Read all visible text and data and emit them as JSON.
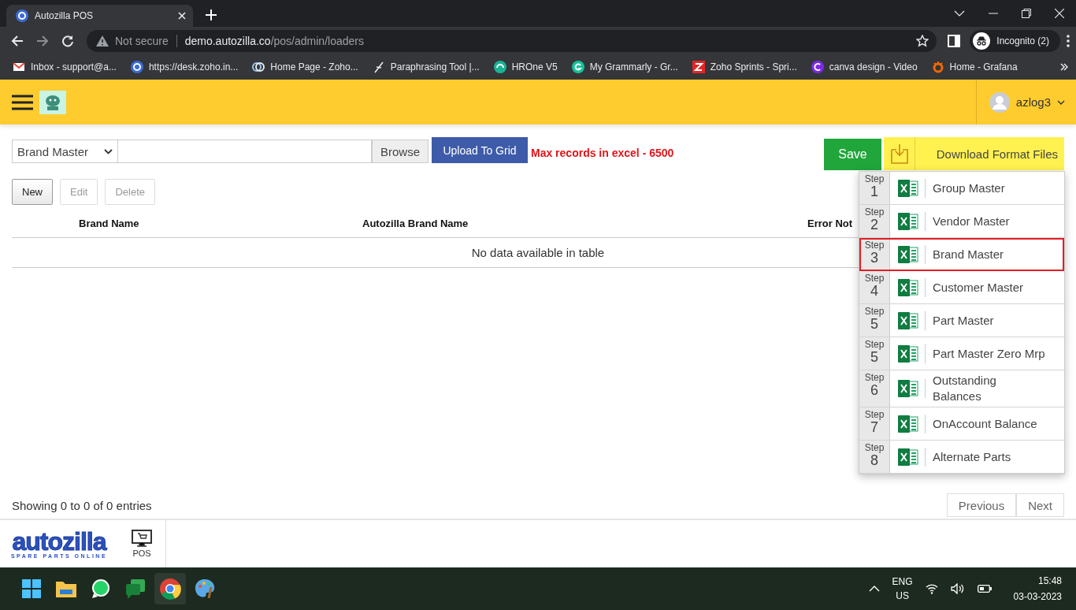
{
  "browser": {
    "tabs": [
      {
        "title": "Autozilla POS",
        "selected": true
      }
    ],
    "url": {
      "security": "Not secure",
      "host": "demo.autozilla.co",
      "path": "/pos/admin/loaders"
    },
    "profile": "Incognito (2)",
    "bookmarks": [
      {
        "label": "Inbox - support@a..."
      },
      {
        "label": "https://desk.zoho.in..."
      },
      {
        "label": "Home Page - Zoho..."
      },
      {
        "label": "Paraphrasing Tool |..."
      },
      {
        "label": "HROne V5"
      },
      {
        "label": "My Grammarly - Gr..."
      },
      {
        "label": "Zoho Sprints - Spri..."
      },
      {
        "label": "canva design - Video"
      },
      {
        "label": "Home - Grafana"
      }
    ]
  },
  "app": {
    "user": "azlog3",
    "loader": {
      "select": "Brand Master",
      "browse": "Browse",
      "upload": "Upload To Grid",
      "note": "Max records in excel - 6500"
    },
    "actions": [
      {
        "label": "New",
        "disabled": false
      },
      {
        "label": "Edit",
        "disabled": true
      },
      {
        "label": "Delete",
        "disabled": true
      }
    ],
    "save": "Save",
    "download": "Download Format Files",
    "format_files": [
      {
        "step_label": "Step",
        "step": "1",
        "name": "Group Master",
        "selected": false
      },
      {
        "step_label": "Step",
        "step": "2",
        "name": "Vendor Master",
        "selected": false
      },
      {
        "step_label": "Step",
        "step": "3",
        "name": "Brand Master",
        "selected": true
      },
      {
        "step_label": "Step",
        "step": "4",
        "name": "Customer Master",
        "selected": false
      },
      {
        "step_label": "Step",
        "step": "5",
        "name": "Part Master",
        "selected": false
      },
      {
        "step_label": "Step",
        "step": "5",
        "name": "Part Master Zero Mrp",
        "selected": false
      },
      {
        "step_label": "Step",
        "step": "6",
        "name": "Outstanding Balances",
        "selected": false
      },
      {
        "step_label": "Step",
        "step": "7",
        "name": "OnAccount Balance",
        "selected": false
      },
      {
        "step_label": "Step",
        "step": "8",
        "name": "Alternate Parts",
        "selected": false
      }
    ],
    "table": {
      "columns": [
        "Brand Name",
        "Autozilla Brand Name",
        "Error Not"
      ],
      "empty": "No data available in table",
      "info": "Showing 0 to 0 of 0 entries"
    },
    "pagination": [
      {
        "label": "Previous"
      },
      {
        "label": "Next"
      }
    ]
  },
  "footer": {
    "brand": "autozilla",
    "tagline": "SPARE PARTS ONLINE",
    "apps": [
      {
        "label": "POS"
      }
    ]
  },
  "taskbar": {
    "language": "ENG",
    "region": "US",
    "time": "15:48",
    "date": "03-03-2023"
  }
}
